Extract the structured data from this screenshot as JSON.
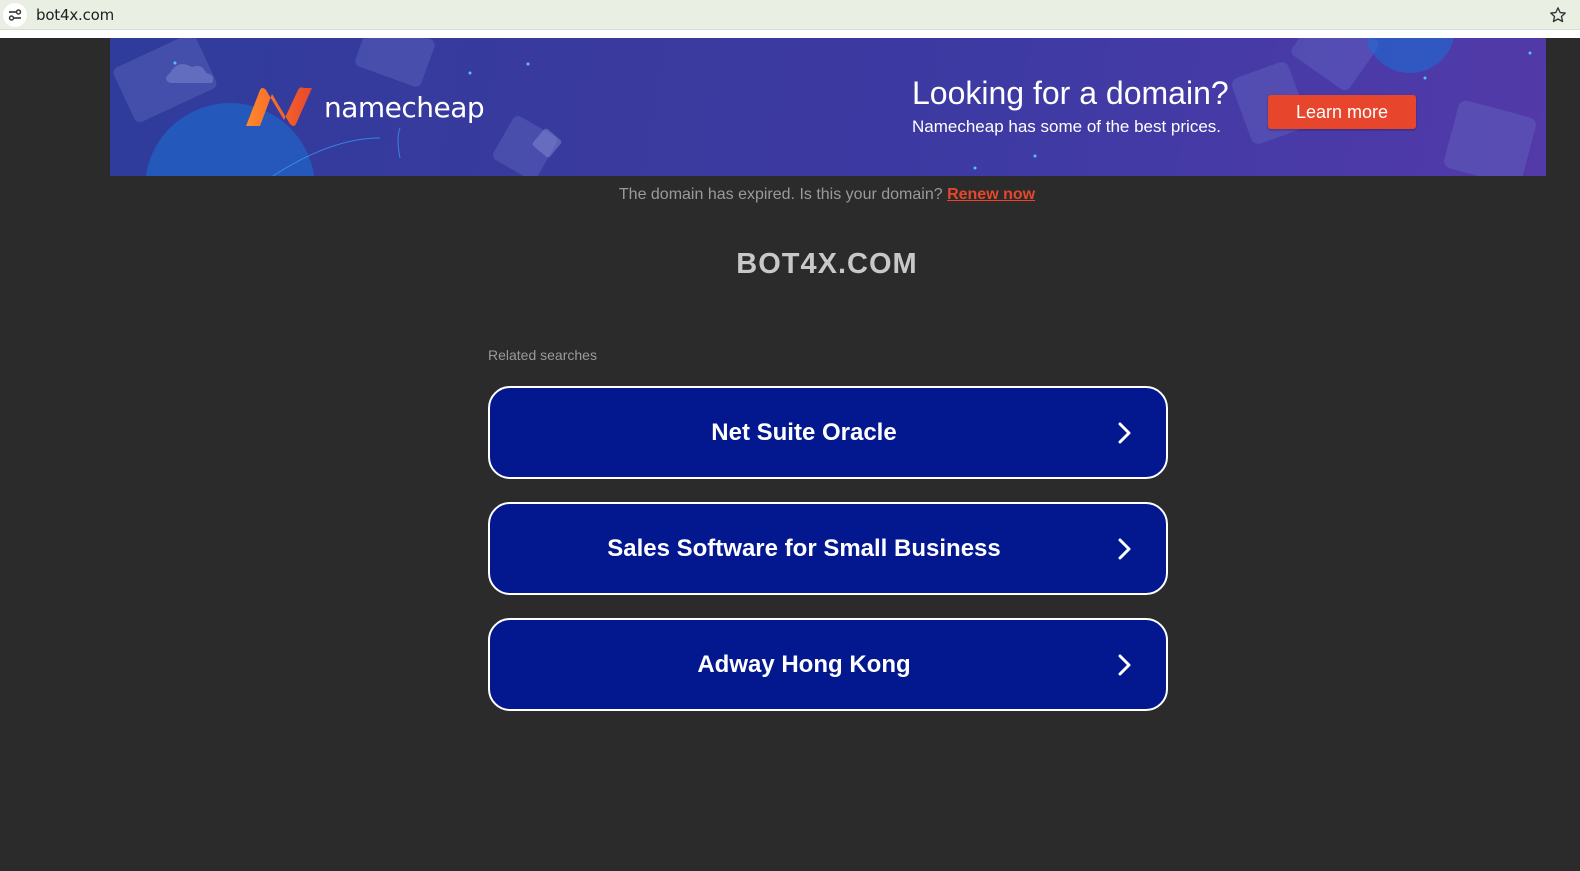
{
  "browser": {
    "url": "bot4x.com"
  },
  "banner": {
    "brand": "namecheap",
    "headline": "Looking for a domain?",
    "subline": "Namecheap has some of the best prices.",
    "cta_label": "Learn more",
    "accent_color": "#e8462c",
    "logo_color_start": "#ff8a2b",
    "logo_color_end": "#e8462c"
  },
  "notice": {
    "text": "The domain has expired. Is this your domain?",
    "link_label": "Renew now"
  },
  "domain_title": "BOT4X.COM",
  "related": {
    "label": "Related searches",
    "items": [
      {
        "label": "Net Suite Oracle",
        "icon": "chevron-right-icon"
      },
      {
        "label": "Sales Software for Small Business",
        "icon": "chevron-right-icon"
      },
      {
        "label": "Adway Hong Kong",
        "icon": "chevron-right-icon"
      }
    ],
    "button_color": "#03188f"
  }
}
